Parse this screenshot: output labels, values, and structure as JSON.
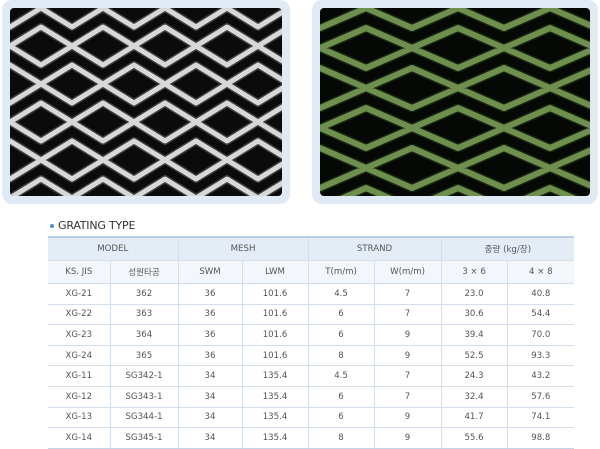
{
  "section_title": "GRATING TYPE",
  "table": {
    "group_headers": [
      "MODEL",
      "MESH",
      "STRAND",
      "중량 (kg/장)"
    ],
    "sub_headers": [
      "KS. JIS",
      "성원타공",
      "SWM",
      "LWM",
      "T(m/m)",
      "W(m/m)",
      "3 × 6",
      "4 × 8"
    ],
    "rows": [
      [
        "XG-21",
        "362",
        "36",
        "101.6",
        "4.5",
        "7",
        "23.0",
        "40.8"
      ],
      [
        "XG-22",
        "363",
        "36",
        "101.6",
        "6",
        "7",
        "30.6",
        "54.4"
      ],
      [
        "XG-23",
        "364",
        "36",
        "101.6",
        "6",
        "9",
        "39.4",
        "70.0"
      ],
      [
        "XG-24",
        "365",
        "36",
        "101.6",
        "8",
        "9",
        "52.5",
        "93.3"
      ],
      [
        "XG-11",
        "SG342-1",
        "34",
        "135.4",
        "4.5",
        "7",
        "24.3",
        "43.2"
      ],
      [
        "XG-12",
        "SG343-1",
        "34",
        "135.4",
        "6",
        "7",
        "32.4",
        "57.6"
      ],
      [
        "XG-13",
        "SG344-1",
        "34",
        "135.4",
        "6",
        "9",
        "41.7",
        "74.1"
      ],
      [
        "XG-14",
        "SG345-1",
        "34",
        "135.4",
        "8",
        "9",
        "55.6",
        "98.8"
      ]
    ]
  },
  "colors": {
    "frame": "#dfeaf4",
    "header_bg": "#e4edf6",
    "subheader_bg": "#f3f7fb",
    "mesh_silver": "#d8d8d8",
    "mesh_green": "#6f8f4e"
  }
}
